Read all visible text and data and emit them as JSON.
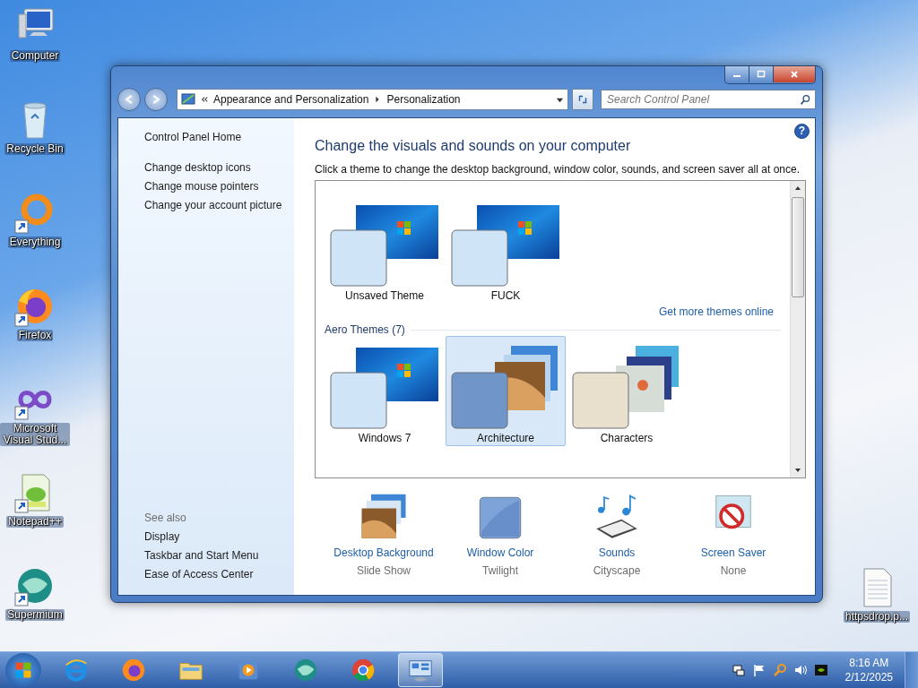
{
  "desktop_icons": [
    {
      "label": "Computer",
      "kind": "computer",
      "shortcut": false
    },
    {
      "label": "Recycle Bin",
      "kind": "bin",
      "shortcut": false
    },
    {
      "label": "Everything",
      "kind": "ring",
      "shortcut": true
    },
    {
      "label": "Firefox",
      "kind": "firefox",
      "shortcut": true
    },
    {
      "label": "Microsoft Visual Stud...",
      "kind": "infinity",
      "shortcut": true
    },
    {
      "label": "Notepad++",
      "kind": "notepad",
      "shortcut": true
    },
    {
      "label": "Supermium",
      "kind": "supermium",
      "shortcut": true
    }
  ],
  "desktop_files": [
    {
      "label": "httpsdrop.p...",
      "kind": "document",
      "shortcut": false
    }
  ],
  "window": {
    "address": {
      "crumbs": [
        "Appearance and Personalization",
        "Personalization"
      ]
    },
    "search": {
      "placeholder": "Search Control Panel"
    },
    "sidebar": {
      "links": [
        "Control Panel Home",
        "Change desktop icons",
        "Change mouse pointers",
        "Change your account picture"
      ],
      "see_also": {
        "heading": "See also",
        "links": [
          "Display",
          "Taskbar and Start Menu",
          "Ease of Access Center"
        ]
      }
    },
    "help": "?",
    "heading": "Change the visuals and sounds on your computer",
    "description": "Click a theme to change the desktop background, window color, sounds, and screen saver all at once.",
    "sections": [
      {
        "themes": [
          {
            "name": "Unsaved Theme",
            "kind": "single",
            "color": "#cfe4f7",
            "selected": false
          },
          {
            "name": "FUCK",
            "kind": "single",
            "color": "#cfe4f7",
            "selected": false
          }
        ],
        "link": "Get more themes online"
      },
      {
        "title": "Aero Themes (7)",
        "themes": [
          {
            "name": "Windows 7",
            "kind": "single",
            "color": "#cfe4f7",
            "selected": false
          },
          {
            "name": "Architecture",
            "kind": "stack",
            "color": "#6f95c9",
            "selected": true
          },
          {
            "name": "Characters",
            "kind": "characters",
            "color": "#e8e0cc",
            "selected": false
          }
        ]
      }
    ],
    "settings": [
      {
        "label": "Desktop Background",
        "value": "Slide Show",
        "kind": "background"
      },
      {
        "label": "Window Color",
        "value": "Twilight",
        "kind": "color"
      },
      {
        "label": "Sounds",
        "value": "Cityscape",
        "kind": "sounds"
      },
      {
        "label": "Screen Saver",
        "value": "None",
        "kind": "screensaver"
      }
    ]
  },
  "taskbar": {
    "apps": [
      {
        "kind": "ie",
        "selected": false
      },
      {
        "kind": "firefox",
        "selected": false
      },
      {
        "kind": "folder",
        "selected": false
      },
      {
        "kind": "media",
        "selected": false
      },
      {
        "kind": "supermium",
        "selected": false
      },
      {
        "kind": "chrome",
        "selected": false
      },
      {
        "kind": "controlpanel",
        "selected": true
      }
    ],
    "tray": [
      {
        "kind": "network"
      },
      {
        "kind": "flag"
      },
      {
        "kind": "search"
      },
      {
        "kind": "volume"
      },
      {
        "kind": "gpu"
      }
    ],
    "time": "8:16 AM",
    "date": "2/12/2025"
  }
}
